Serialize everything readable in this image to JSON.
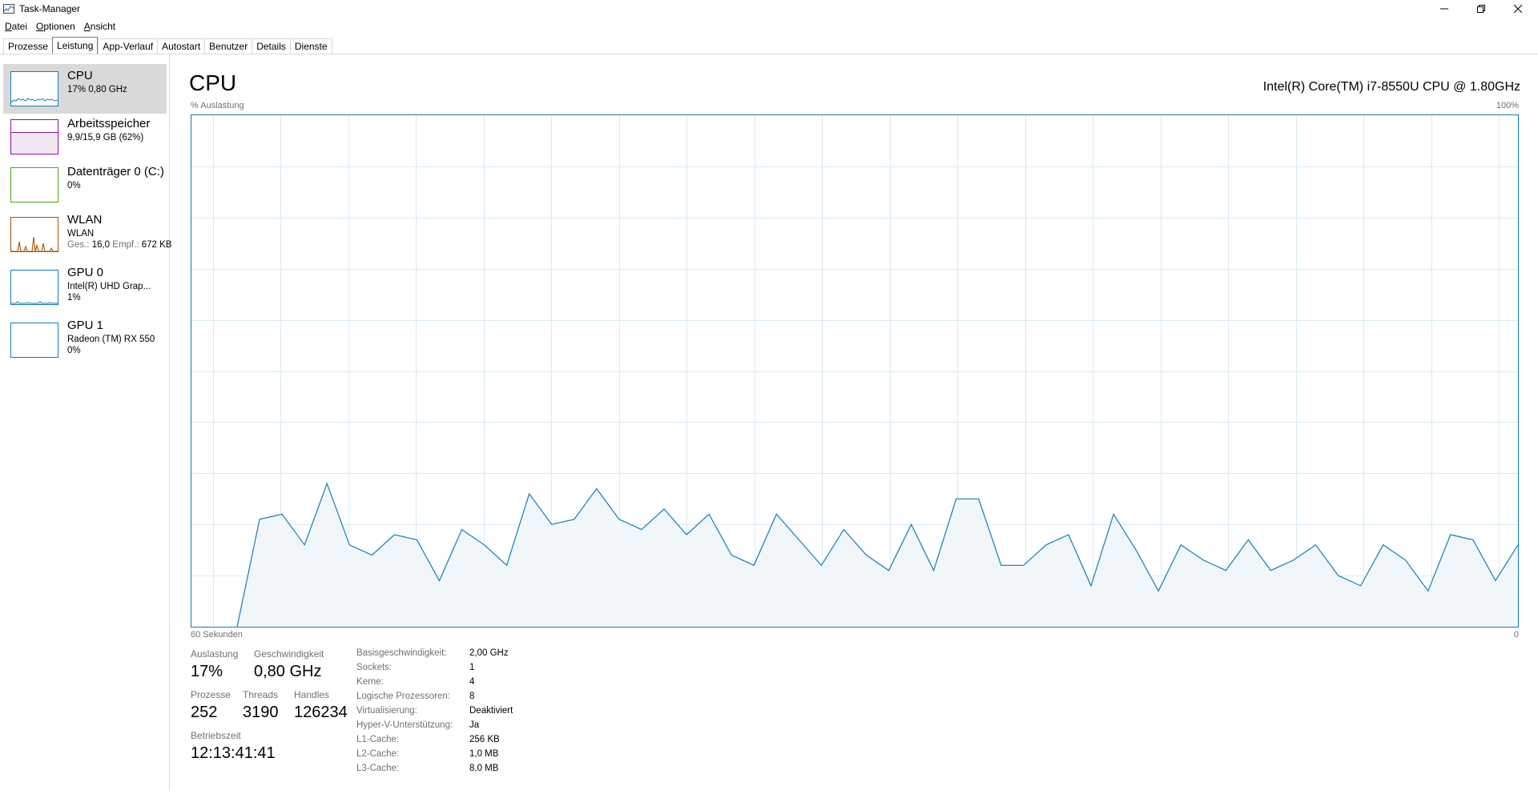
{
  "window": {
    "title": "Task-Manager"
  },
  "menu": [
    {
      "first": "D",
      "rest": "atei"
    },
    {
      "first": "O",
      "rest": "ptionen"
    },
    {
      "first": "A",
      "rest": "nsicht"
    }
  ],
  "tabs": [
    "Prozesse",
    "Leistung",
    "App-Verlauf",
    "Autostart",
    "Benutzer",
    "Details",
    "Dienste"
  ],
  "active_tab": "Leistung",
  "sidebar": {
    "cpu": {
      "title": "CPU",
      "sub": "17% 0,80 GHz",
      "color": "#117dbb"
    },
    "memory": {
      "title": "Arbeitsspeicher",
      "sub": "9,9/15,9 GB (62%)",
      "color": "#8b12ae"
    },
    "disk": {
      "title": "Datenträger 0 (C:)",
      "sub": "0%",
      "color": "#4da60c"
    },
    "wlan": {
      "title": "WLAN",
      "sub1": "WLAN",
      "send_label": "Ges.:",
      "send_value": "16,0",
      "recv_label": "Empf.:",
      "recv_value": "672 KB",
      "color": "#a74f01"
    },
    "gpu0": {
      "title": "GPU 0",
      "sub1": "Intel(R) UHD Grap...",
      "sub2": "1%",
      "color": "#117dbb"
    },
    "gpu1": {
      "title": "GPU 1",
      "sub1": "Radeon (TM) RX 550",
      "sub2": "0%",
      "color": "#117dbb"
    }
  },
  "main": {
    "title": "CPU",
    "cpu_name": "Intel(R) Core(TM) i7-8550U CPU @ 1.80GHz",
    "y_label": "% Auslastung",
    "y_max_label": "100%",
    "x_left_label": "60 Sekunden",
    "x_right_label": "0"
  },
  "chart_data": {
    "type": "area",
    "ylim": [
      0,
      100
    ],
    "xlim": [
      60,
      0
    ],
    "x_unit": "seconds ago",
    "ylabel": "% Auslastung",
    "grid": true,
    "values": [
      0,
      21,
      22,
      16,
      28,
      16,
      14,
      18,
      17,
      9,
      19,
      16,
      12,
      26,
      20,
      21,
      27,
      21,
      19,
      23,
      18,
      22,
      14,
      12,
      22,
      17,
      12,
      19,
      14,
      11,
      20,
      11,
      25,
      25,
      12,
      12,
      16,
      18,
      8,
      22,
      15,
      7,
      16,
      13,
      11,
      17,
      11,
      13,
      16,
      10,
      8,
      16,
      13,
      7,
      18,
      17,
      9,
      16
    ],
    "color": "#117dbb"
  },
  "stats": {
    "auslastung": {
      "label": "Auslastung",
      "value": "17%"
    },
    "geschwindigkeit": {
      "label": "Geschwindigkeit",
      "value": "0,80 GHz"
    },
    "prozesse": {
      "label": "Prozesse",
      "value": "252"
    },
    "threads": {
      "label": "Threads",
      "value": "3190"
    },
    "handles": {
      "label": "Handles",
      "value": "126234"
    },
    "betriebszeit": {
      "label": "Betriebszeit",
      "value": "12:13:41:41"
    }
  },
  "info": [
    {
      "k": "Basisgeschwindigkeit:",
      "v": "2,00 GHz"
    },
    {
      "k": "Sockets:",
      "v": "1"
    },
    {
      "k": "Kerne:",
      "v": "4"
    },
    {
      "k": "Logische Prozessoren:",
      "v": "8"
    },
    {
      "k": "Virtualisierung:",
      "v": "Deaktiviert"
    },
    {
      "k": "Hyper-V-Unterstützung:",
      "v": "Ja"
    },
    {
      "k": "L1-Cache:",
      "v": "256 KB"
    },
    {
      "k": "L2-Cache:",
      "v": "1,0 MB"
    },
    {
      "k": "L3-Cache:",
      "v": "8,0 MB"
    }
  ]
}
